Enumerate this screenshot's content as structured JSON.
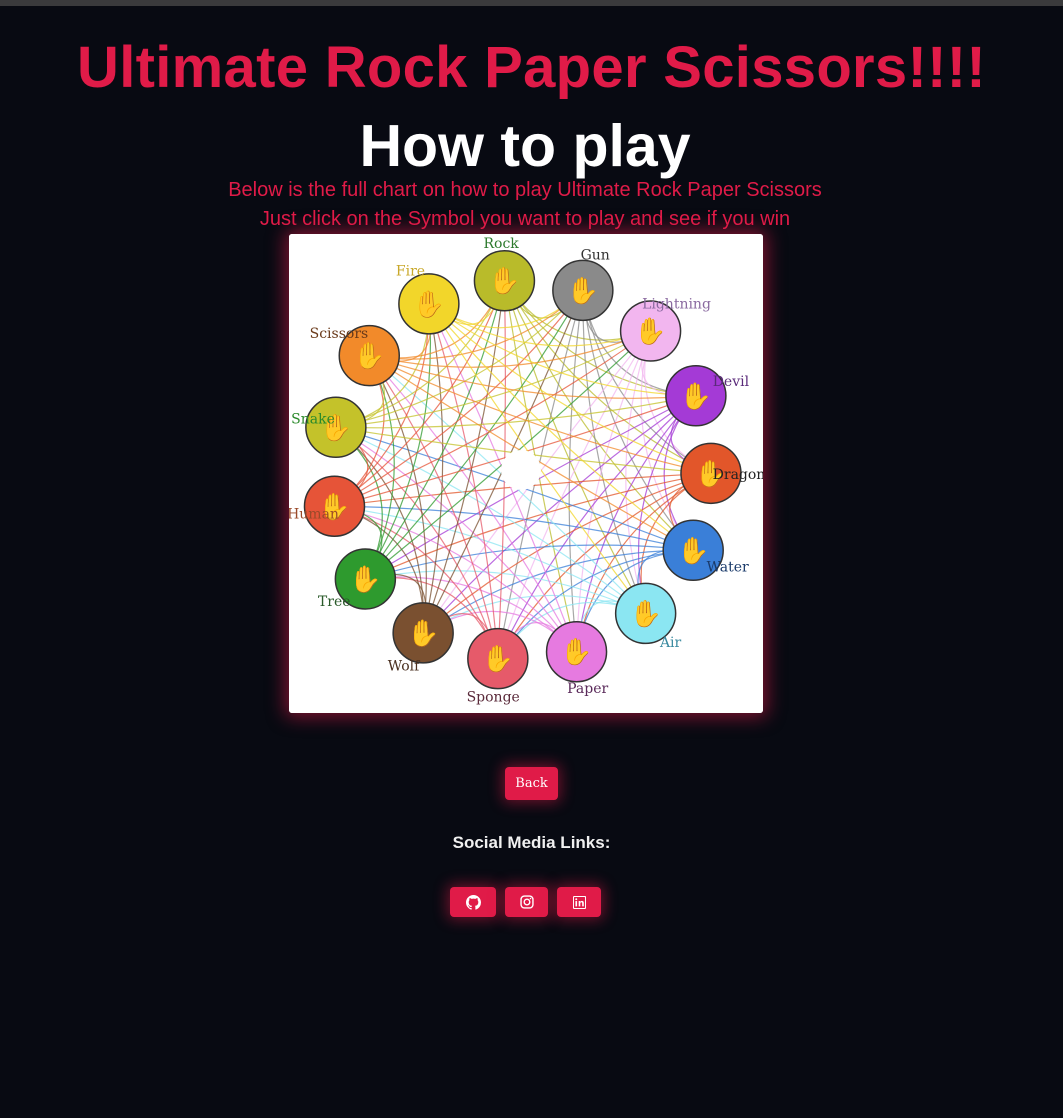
{
  "header": {
    "title": "Ultimate Rock Paper Scissors!!!!",
    "subtitle": "How to play",
    "description_line1": "Below is the full chart on how to play Ultimate Rock Paper Scissors",
    "description_line2": "Just click on the Symbol you want to play and see if you win"
  },
  "chart": {
    "symbols": [
      {
        "name": "Rock",
        "color": "#b9bb2a",
        "label_color": "#2d7a2d"
      },
      {
        "name": "Gun",
        "color": "#8a8a8a",
        "label_color": "#333333"
      },
      {
        "name": "Lightning",
        "color": "#f2b6ef",
        "label_color": "#8a6aa0"
      },
      {
        "name": "Devil",
        "color": "#a43ad6",
        "label_color": "#5a2a7a"
      },
      {
        "name": "Dragon",
        "color": "#e2562a",
        "label_color": "#222222"
      },
      {
        "name": "Water",
        "color": "#3a7fd8",
        "label_color": "#1a3a6a"
      },
      {
        "name": "Air",
        "color": "#8be6f2",
        "label_color": "#3a8aa0"
      },
      {
        "name": "Paper",
        "color": "#e67ae0",
        "label_color": "#5a2a5a"
      },
      {
        "name": "Sponge",
        "color": "#e65a6a",
        "label_color": "#5a2a3a"
      },
      {
        "name": "Wolf",
        "color": "#7a5030",
        "label_color": "#4a3020"
      },
      {
        "name": "Tree",
        "color": "#2e9a2e",
        "label_color": "#2a5a2a"
      },
      {
        "name": "Human",
        "color": "#e65438",
        "label_color": "#9a4a2a"
      },
      {
        "name": "Snake",
        "color": "#c4c22a",
        "label_color": "#2a8a2a"
      },
      {
        "name": "Scissors",
        "color": "#f28a2a",
        "label_color": "#6a3a1a"
      },
      {
        "name": "Fire",
        "color": "#f2d62a",
        "label_color": "#c8a82a"
      }
    ],
    "hand_icon": "✋"
  },
  "buttons": {
    "back_label": "Back"
  },
  "social": {
    "heading": "Social Media Links:",
    "links": [
      {
        "icon": "github-icon"
      },
      {
        "icon": "instagram-icon"
      },
      {
        "icon": "linkedin-icon"
      }
    ]
  },
  "colors": {
    "accent": "#e01b48",
    "background": "#080a12"
  }
}
